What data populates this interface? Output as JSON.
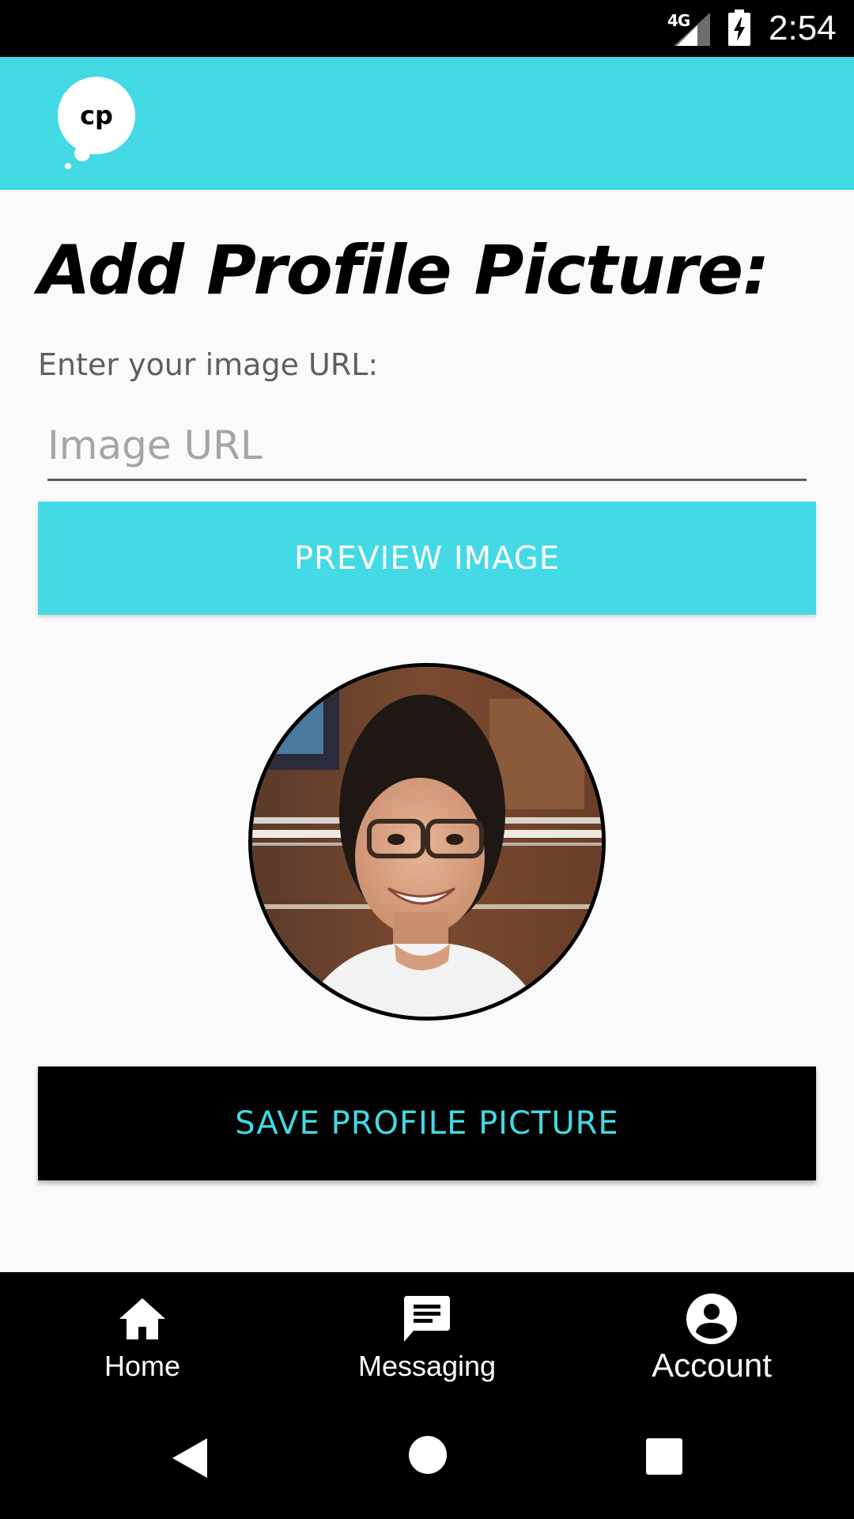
{
  "status_bar": {
    "network": "4G",
    "time": "2:54"
  },
  "app_bar": {
    "logo_text": "cp"
  },
  "main": {
    "title": "Add Profile Picture:",
    "url_label": "Enter your image URL:",
    "url_input": {
      "value": "",
      "placeholder": "Image URL"
    },
    "preview_button_label": "PREVIEW IMAGE",
    "save_button_label": "SAVE PROFILE PICTURE"
  },
  "bottom_nav": {
    "items": [
      {
        "label": "Home",
        "icon": "home-icon"
      },
      {
        "label": "Messaging",
        "icon": "message-icon"
      },
      {
        "label": "Account",
        "icon": "account-circle-icon",
        "active": true
      }
    ]
  },
  "system_nav": {
    "buttons": [
      "back-icon",
      "home-circle-icon",
      "recents-icon"
    ]
  },
  "colors": {
    "accent": "#43d9e5",
    "background": "#fafafa",
    "nav_background": "#000000"
  }
}
